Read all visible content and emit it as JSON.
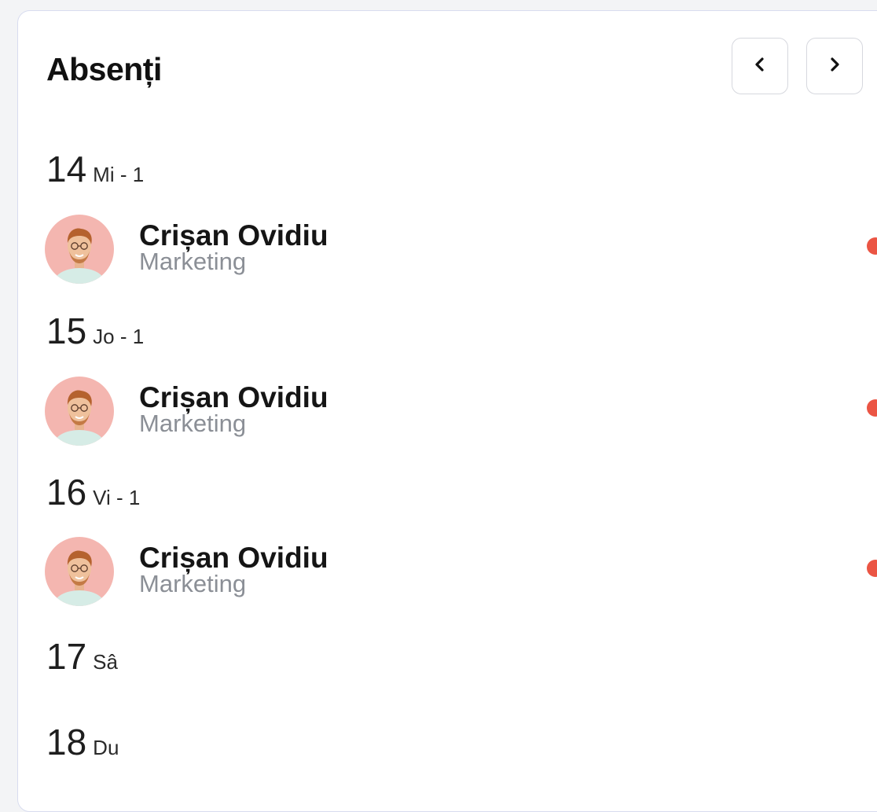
{
  "widget": {
    "title": "Absenți",
    "prev_icon": "chevron-left-icon",
    "next_icon": "chevron-right-icon"
  },
  "colors": {
    "status_absent": "#eb5544",
    "avatar_bg": "#f4b6b0",
    "shirt": "#d6ece6"
  },
  "days": [
    {
      "number": "14",
      "meta": "Mi - 1",
      "people": [
        {
          "name": "Crișan Ovidiu",
          "department": "Marketing",
          "avatar_icon": "user-avatar"
        }
      ]
    },
    {
      "number": "15",
      "meta": "Jo - 1",
      "people": [
        {
          "name": "Crișan Ovidiu",
          "department": "Marketing",
          "avatar_icon": "user-avatar"
        }
      ]
    },
    {
      "number": "16",
      "meta": "Vi - 1",
      "people": [
        {
          "name": "Crișan Ovidiu",
          "department": "Marketing",
          "avatar_icon": "user-avatar"
        }
      ]
    },
    {
      "number": "17",
      "meta": "Sâ",
      "people": []
    },
    {
      "number": "18",
      "meta": "Du",
      "people": []
    }
  ]
}
